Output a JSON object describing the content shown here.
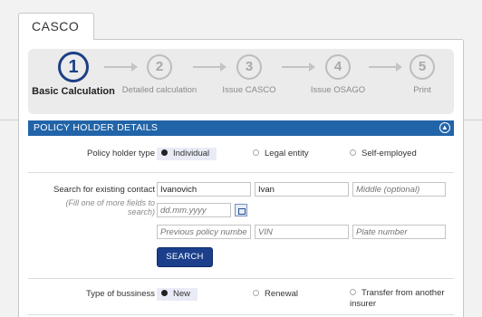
{
  "tab": {
    "title": "CASCO"
  },
  "steps": [
    {
      "number": "1",
      "label": "Basic Calculation"
    },
    {
      "number": "2",
      "label": "Detailed calculation"
    },
    {
      "number": "3",
      "label": "Issue CASCO"
    },
    {
      "number": "4",
      "label": "Issue OSAGO"
    },
    {
      "number": "5",
      "label": "Print"
    }
  ],
  "section": {
    "title": "POLICY HOLDER DETAILS",
    "collapse_icon": "chevron-up-icon"
  },
  "holder_type": {
    "label": "Policy holder type",
    "options": [
      "Individual",
      "Legal entity",
      "Self-employed"
    ],
    "selected": "Individual"
  },
  "search": {
    "label": "Search for existing contact",
    "hint": "(Fill one of more fields to search)",
    "last_name": "Ivanovich",
    "first_name": "Ivan",
    "middle_placeholder": "Middle (optional)",
    "date_placeholder": "dd.mm.yyyy",
    "prev_policy_placeholder": "Previous policy number",
    "vin_placeholder": "VIN",
    "plate_placeholder": "Plate number",
    "button": "SEARCH"
  },
  "business_type": {
    "label": "Type of bussiness",
    "options": [
      "New",
      "Renewal",
      "Transfer from another insurer"
    ],
    "selected": "New"
  }
}
